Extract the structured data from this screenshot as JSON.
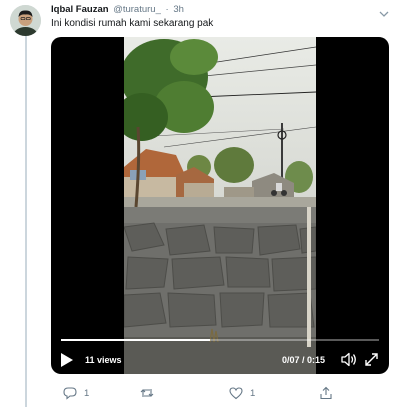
{
  "tweet": {
    "author_name": "Iqbal Fauzan",
    "handle": "@turaturu_",
    "separator": "·",
    "time": "3h",
    "text": "Ini kondisi rumah kami sekarang pak"
  },
  "video": {
    "views": "11 views",
    "time_display": "0/07 / 0:15",
    "progress": 0.47
  },
  "actions": {
    "reply_count": "1",
    "retweet_count": "",
    "like_count": "1"
  },
  "icons": {
    "avatar": "avatar-icon",
    "caret": "chevron-down-icon",
    "play": "play-icon",
    "volume": "volume-icon",
    "fullscreen": "fullscreen-icon",
    "reply": "reply-icon",
    "retweet": "retweet-icon",
    "like": "heart-icon",
    "share": "share-icon"
  },
  "colors": {
    "text_primary": "#14171a",
    "text_secondary": "#657786",
    "thread_line": "#ccd6dd"
  }
}
